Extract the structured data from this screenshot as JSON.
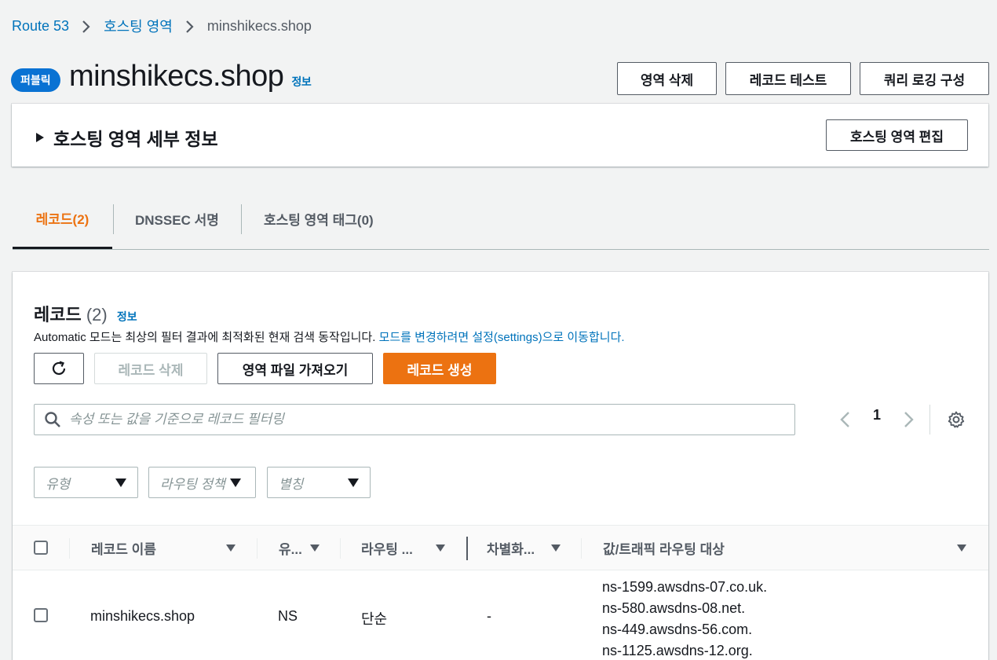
{
  "breadcrumb": {
    "items": [
      "Route 53",
      "호스팅 영역",
      "minshikecs.shop"
    ]
  },
  "header": {
    "badge": "퍼블릭",
    "title": "minshikecs.shop",
    "info": "정보",
    "buttons": [
      "영역 삭제",
      "레코드 테스트",
      "쿼리 로깅 구성"
    ]
  },
  "details": {
    "title": "호스팅 영역 세부 정보",
    "edit_button": "호스팅 영역 편집"
  },
  "tabs": [
    {
      "label": "레코드(2)",
      "active": true
    },
    {
      "label": "DNSSEC 서명",
      "active": false
    },
    {
      "label": "호스팅 영역 태그(0)",
      "active": false
    }
  ],
  "records": {
    "title": "레코드",
    "count": "(2)",
    "info": "정보",
    "description": "Automatic 모드는 최상의 필터 결과에 최적화된 현재 검색 동작입니다. ",
    "description_link": "모드를 변경하려면 설정(settings)으로 이동합니다.",
    "actions": {
      "refresh": "refresh",
      "delete": "레코드 삭제",
      "import": "영역 파일 가져오기",
      "create": "레코드 생성"
    },
    "search_placeholder": "속성 또는 값을 기준으로 레코드 필터링",
    "page": "1",
    "filters": [
      "유형",
      "라우팅 정책",
      "별칭"
    ],
    "columns": [
      "레코드 이름",
      "유...",
      "라우팅 ...",
      "차별화...",
      "값/트래픽 라우팅 대상"
    ],
    "rows": [
      {
        "name": "minshikecs.shop",
        "type": "NS",
        "routing": "단순",
        "differentiator": "-",
        "values": [
          "ns-1599.awsdns-07.co.uk.",
          "ns-580.awsdns-08.net.",
          "ns-449.awsdns-56.com.",
          "ns-1125.awsdns-12.org."
        ]
      }
    ]
  },
  "colors": {
    "accent": "#ec7211",
    "link": "#0073bb",
    "badge": "#0972d3"
  }
}
